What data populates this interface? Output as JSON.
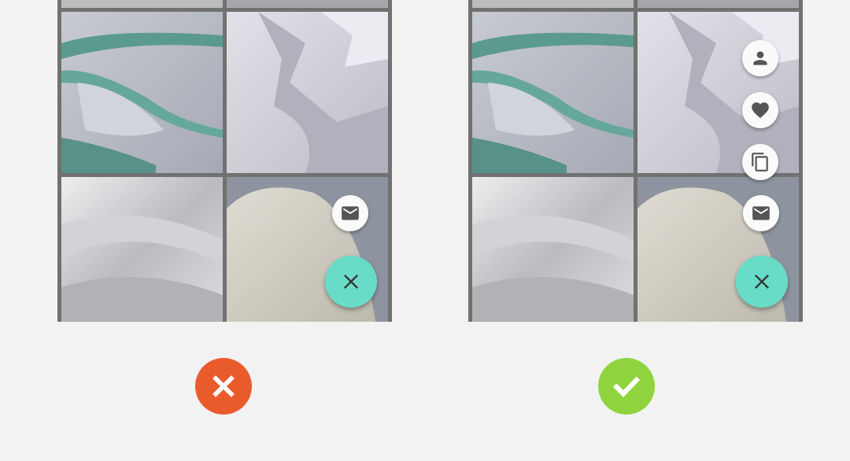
{
  "colors": {
    "fab": "#69dcc8",
    "fab_icon": "#333333",
    "mini_fab": "#fafafa",
    "mini_icon": "#555555",
    "incorrect": "#ea5b2c",
    "correct": "#8fd43e",
    "background": "#f2f2f2"
  },
  "examples": [
    {
      "verdict": "incorrect",
      "verdict_icon": "cross-icon",
      "actions": [
        "mail-icon"
      ],
      "fab_icon": "close-icon"
    },
    {
      "verdict": "correct",
      "verdict_icon": "check-icon",
      "actions": [
        "person-icon",
        "heart-icon",
        "copy-icon",
        "mail-icon"
      ],
      "fab_icon": "close-icon"
    }
  ]
}
